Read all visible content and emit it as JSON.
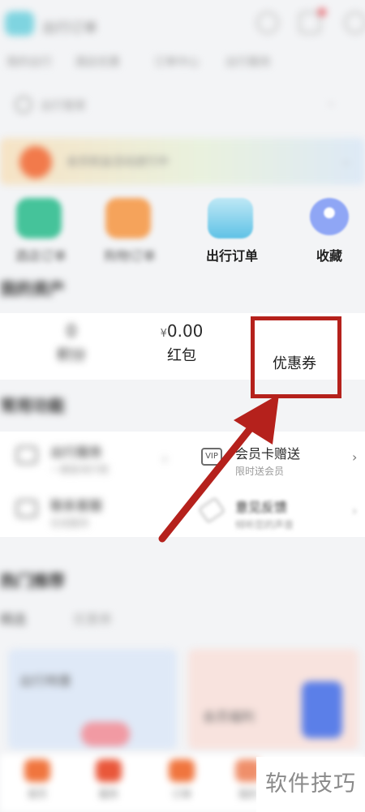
{
  "header": {
    "app_name": "出行订单",
    "tabs": [
      "我的出行",
      "酒店优惠",
      "订单中心",
      "出行服务"
    ]
  },
  "location": {
    "text": "出行管家",
    "chevron": "⌄"
  },
  "banner": {
    "text": "会员权益活动进行中",
    "chevron": "⌄"
  },
  "quick_actions": [
    {
      "label": "酒店订单",
      "color": "#45c39a"
    },
    {
      "label": "购物订单",
      "color": "#f5a35b"
    },
    {
      "label": "出行订单",
      "color": "#5fc2e6"
    },
    {
      "label": "收藏",
      "color": "#6f8ef0"
    }
  ],
  "assets": {
    "title": "我的资产",
    "points": {
      "value": "0",
      "label": "积分"
    },
    "red_packet": {
      "currency": "¥",
      "value": "0.00",
      "label": "红包"
    },
    "coupon": {
      "label": "优惠券"
    }
  },
  "tools": {
    "title": "常用功能",
    "items": [
      {
        "title": "出行服务",
        "subtitle": "一键查询行程",
        "icon": "calendar-icon",
        "chevron": "›"
      },
      {
        "title": "会员卡赠送",
        "subtitle": "限时送会员",
        "icon_text": "VIP",
        "icon": "vip-card-icon",
        "chevron": "›"
      },
      {
        "title": "联系客服",
        "subtitle": "在线服务",
        "icon": "service-icon",
        "chevron": "›"
      },
      {
        "title": "意见反馈",
        "subtitle": "倾听您的声音",
        "icon": "feedback-icon",
        "chevron": "›"
      }
    ]
  },
  "recommend": {
    "title": "热门推荐",
    "tabs": [
      "精选",
      "优惠券"
    ]
  },
  "promos": [
    {
      "title": "出行特惠",
      "color": "#dfe9f7"
    },
    {
      "title": "会员福利",
      "color": "#f8e3de"
    }
  ],
  "bottom_nav": [
    "首页",
    "服务",
    "订单",
    "我的"
  ],
  "watermark": "软件技巧",
  "colors": {
    "highlight": "#b5211c",
    "accent": "#f0753e"
  }
}
